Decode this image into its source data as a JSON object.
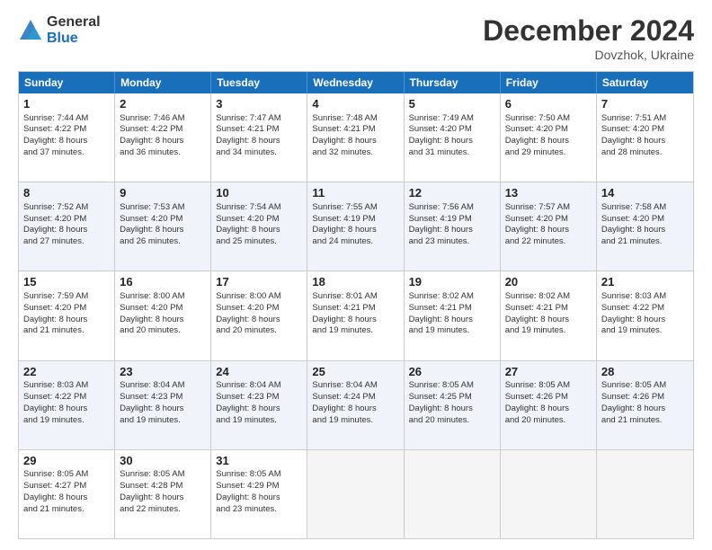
{
  "logo": {
    "general": "General",
    "blue": "Blue"
  },
  "title": "December 2024",
  "location": "Dovzhok, Ukraine",
  "days_header": [
    "Sunday",
    "Monday",
    "Tuesday",
    "Wednesday",
    "Thursday",
    "Friday",
    "Saturday"
  ],
  "weeks": [
    [
      {
        "day": "1",
        "lines": [
          "Sunrise: 7:44 AM",
          "Sunset: 4:22 PM",
          "Daylight: 8 hours",
          "and 37 minutes."
        ]
      },
      {
        "day": "2",
        "lines": [
          "Sunrise: 7:46 AM",
          "Sunset: 4:22 PM",
          "Daylight: 8 hours",
          "and 36 minutes."
        ]
      },
      {
        "day": "3",
        "lines": [
          "Sunrise: 7:47 AM",
          "Sunset: 4:21 PM",
          "Daylight: 8 hours",
          "and 34 minutes."
        ]
      },
      {
        "day": "4",
        "lines": [
          "Sunrise: 7:48 AM",
          "Sunset: 4:21 PM",
          "Daylight: 8 hours",
          "and 32 minutes."
        ]
      },
      {
        "day": "5",
        "lines": [
          "Sunrise: 7:49 AM",
          "Sunset: 4:20 PM",
          "Daylight: 8 hours",
          "and 31 minutes."
        ]
      },
      {
        "day": "6",
        "lines": [
          "Sunrise: 7:50 AM",
          "Sunset: 4:20 PM",
          "Daylight: 8 hours",
          "and 29 minutes."
        ]
      },
      {
        "day": "7",
        "lines": [
          "Sunrise: 7:51 AM",
          "Sunset: 4:20 PM",
          "Daylight: 8 hours",
          "and 28 minutes."
        ]
      }
    ],
    [
      {
        "day": "8",
        "lines": [
          "Sunrise: 7:52 AM",
          "Sunset: 4:20 PM",
          "Daylight: 8 hours",
          "and 27 minutes."
        ]
      },
      {
        "day": "9",
        "lines": [
          "Sunrise: 7:53 AM",
          "Sunset: 4:20 PM",
          "Daylight: 8 hours",
          "and 26 minutes."
        ]
      },
      {
        "day": "10",
        "lines": [
          "Sunrise: 7:54 AM",
          "Sunset: 4:20 PM",
          "Daylight: 8 hours",
          "and 25 minutes."
        ]
      },
      {
        "day": "11",
        "lines": [
          "Sunrise: 7:55 AM",
          "Sunset: 4:19 PM",
          "Daylight: 8 hours",
          "and 24 minutes."
        ]
      },
      {
        "day": "12",
        "lines": [
          "Sunrise: 7:56 AM",
          "Sunset: 4:19 PM",
          "Daylight: 8 hours",
          "and 23 minutes."
        ]
      },
      {
        "day": "13",
        "lines": [
          "Sunrise: 7:57 AM",
          "Sunset: 4:20 PM",
          "Daylight: 8 hours",
          "and 22 minutes."
        ]
      },
      {
        "day": "14",
        "lines": [
          "Sunrise: 7:58 AM",
          "Sunset: 4:20 PM",
          "Daylight: 8 hours",
          "and 21 minutes."
        ]
      }
    ],
    [
      {
        "day": "15",
        "lines": [
          "Sunrise: 7:59 AM",
          "Sunset: 4:20 PM",
          "Daylight: 8 hours",
          "and 21 minutes."
        ]
      },
      {
        "day": "16",
        "lines": [
          "Sunrise: 8:00 AM",
          "Sunset: 4:20 PM",
          "Daylight: 8 hours",
          "and 20 minutes."
        ]
      },
      {
        "day": "17",
        "lines": [
          "Sunrise: 8:00 AM",
          "Sunset: 4:20 PM",
          "Daylight: 8 hours",
          "and 20 minutes."
        ]
      },
      {
        "day": "18",
        "lines": [
          "Sunrise: 8:01 AM",
          "Sunset: 4:21 PM",
          "Daylight: 8 hours",
          "and 19 minutes."
        ]
      },
      {
        "day": "19",
        "lines": [
          "Sunrise: 8:02 AM",
          "Sunset: 4:21 PM",
          "Daylight: 8 hours",
          "and 19 minutes."
        ]
      },
      {
        "day": "20",
        "lines": [
          "Sunrise: 8:02 AM",
          "Sunset: 4:21 PM",
          "Daylight: 8 hours",
          "and 19 minutes."
        ]
      },
      {
        "day": "21",
        "lines": [
          "Sunrise: 8:03 AM",
          "Sunset: 4:22 PM",
          "Daylight: 8 hours",
          "and 19 minutes."
        ]
      }
    ],
    [
      {
        "day": "22",
        "lines": [
          "Sunrise: 8:03 AM",
          "Sunset: 4:22 PM",
          "Daylight: 8 hours",
          "and 19 minutes."
        ]
      },
      {
        "day": "23",
        "lines": [
          "Sunrise: 8:04 AM",
          "Sunset: 4:23 PM",
          "Daylight: 8 hours",
          "and 19 minutes."
        ]
      },
      {
        "day": "24",
        "lines": [
          "Sunrise: 8:04 AM",
          "Sunset: 4:23 PM",
          "Daylight: 8 hours",
          "and 19 minutes."
        ]
      },
      {
        "day": "25",
        "lines": [
          "Sunrise: 8:04 AM",
          "Sunset: 4:24 PM",
          "Daylight: 8 hours",
          "and 19 minutes."
        ]
      },
      {
        "day": "26",
        "lines": [
          "Sunrise: 8:05 AM",
          "Sunset: 4:25 PM",
          "Daylight: 8 hours",
          "and 20 minutes."
        ]
      },
      {
        "day": "27",
        "lines": [
          "Sunrise: 8:05 AM",
          "Sunset: 4:26 PM",
          "Daylight: 8 hours",
          "and 20 minutes."
        ]
      },
      {
        "day": "28",
        "lines": [
          "Sunrise: 8:05 AM",
          "Sunset: 4:26 PM",
          "Daylight: 8 hours",
          "and 21 minutes."
        ]
      }
    ],
    [
      {
        "day": "29",
        "lines": [
          "Sunrise: 8:05 AM",
          "Sunset: 4:27 PM",
          "Daylight: 8 hours",
          "and 21 minutes."
        ]
      },
      {
        "day": "30",
        "lines": [
          "Sunrise: 8:05 AM",
          "Sunset: 4:28 PM",
          "Daylight: 8 hours",
          "and 22 minutes."
        ]
      },
      {
        "day": "31",
        "lines": [
          "Sunrise: 8:05 AM",
          "Sunset: 4:29 PM",
          "Daylight: 8 hours",
          "and 23 minutes."
        ]
      },
      {
        "day": "",
        "lines": []
      },
      {
        "day": "",
        "lines": []
      },
      {
        "day": "",
        "lines": []
      },
      {
        "day": "",
        "lines": []
      }
    ]
  ]
}
